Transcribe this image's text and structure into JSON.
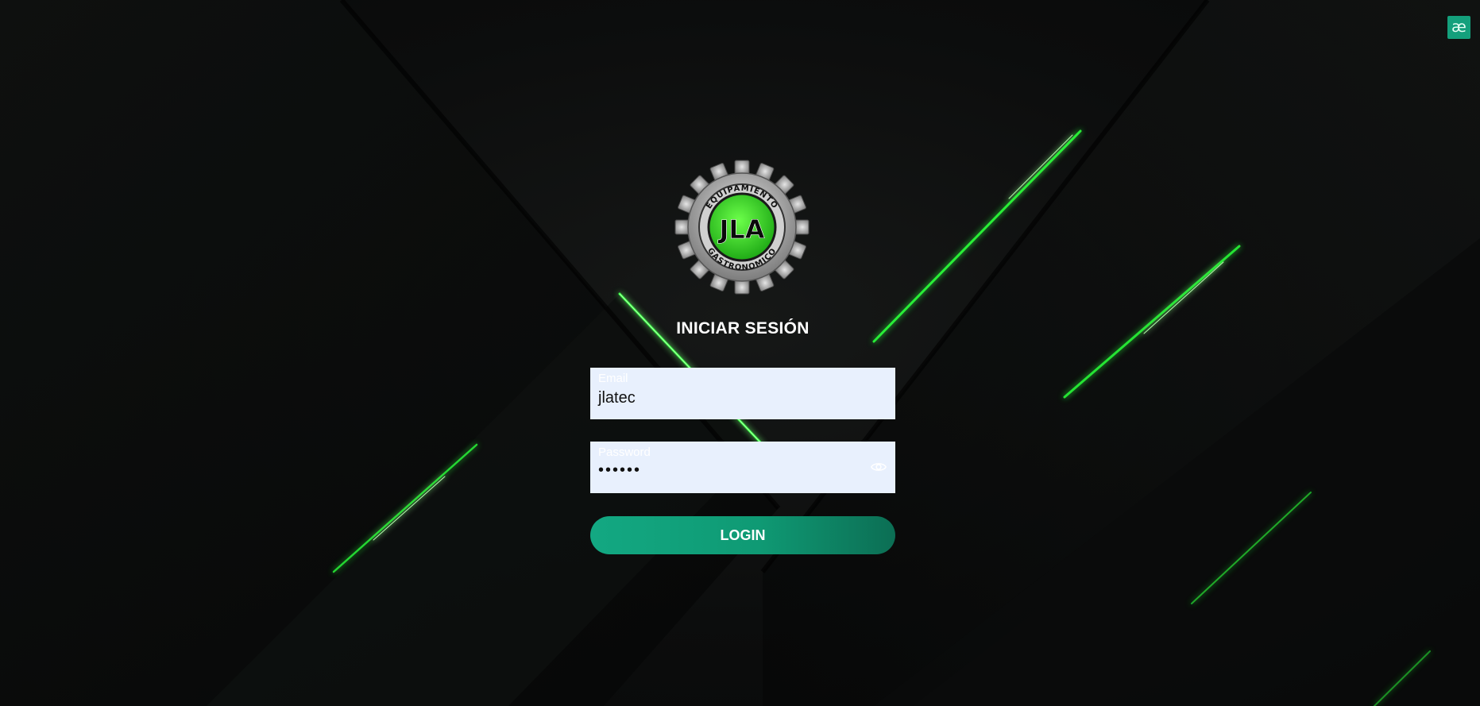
{
  "corner_badge": {
    "text": "æ",
    "color": "#14a07c"
  },
  "logo": {
    "icon": "jla-gear-logo-icon",
    "top_text": "EQUIPAMIENTO",
    "center_text": "JLA",
    "bottom_text": "GASTRONOMICO",
    "accent": "#3ddc2a"
  },
  "title": "INICIAR SESIÓN",
  "form": {
    "email": {
      "label": "Email",
      "value": "jlatec"
    },
    "password": {
      "label": "Password",
      "value": "••••••",
      "toggle_icon": "eye-icon"
    },
    "login_label": "LOGIN"
  },
  "colors": {
    "background": "#0b0c0c",
    "neon": "#2bff3a",
    "field_bg": "#e8f0fd",
    "button": "#13a882"
  }
}
